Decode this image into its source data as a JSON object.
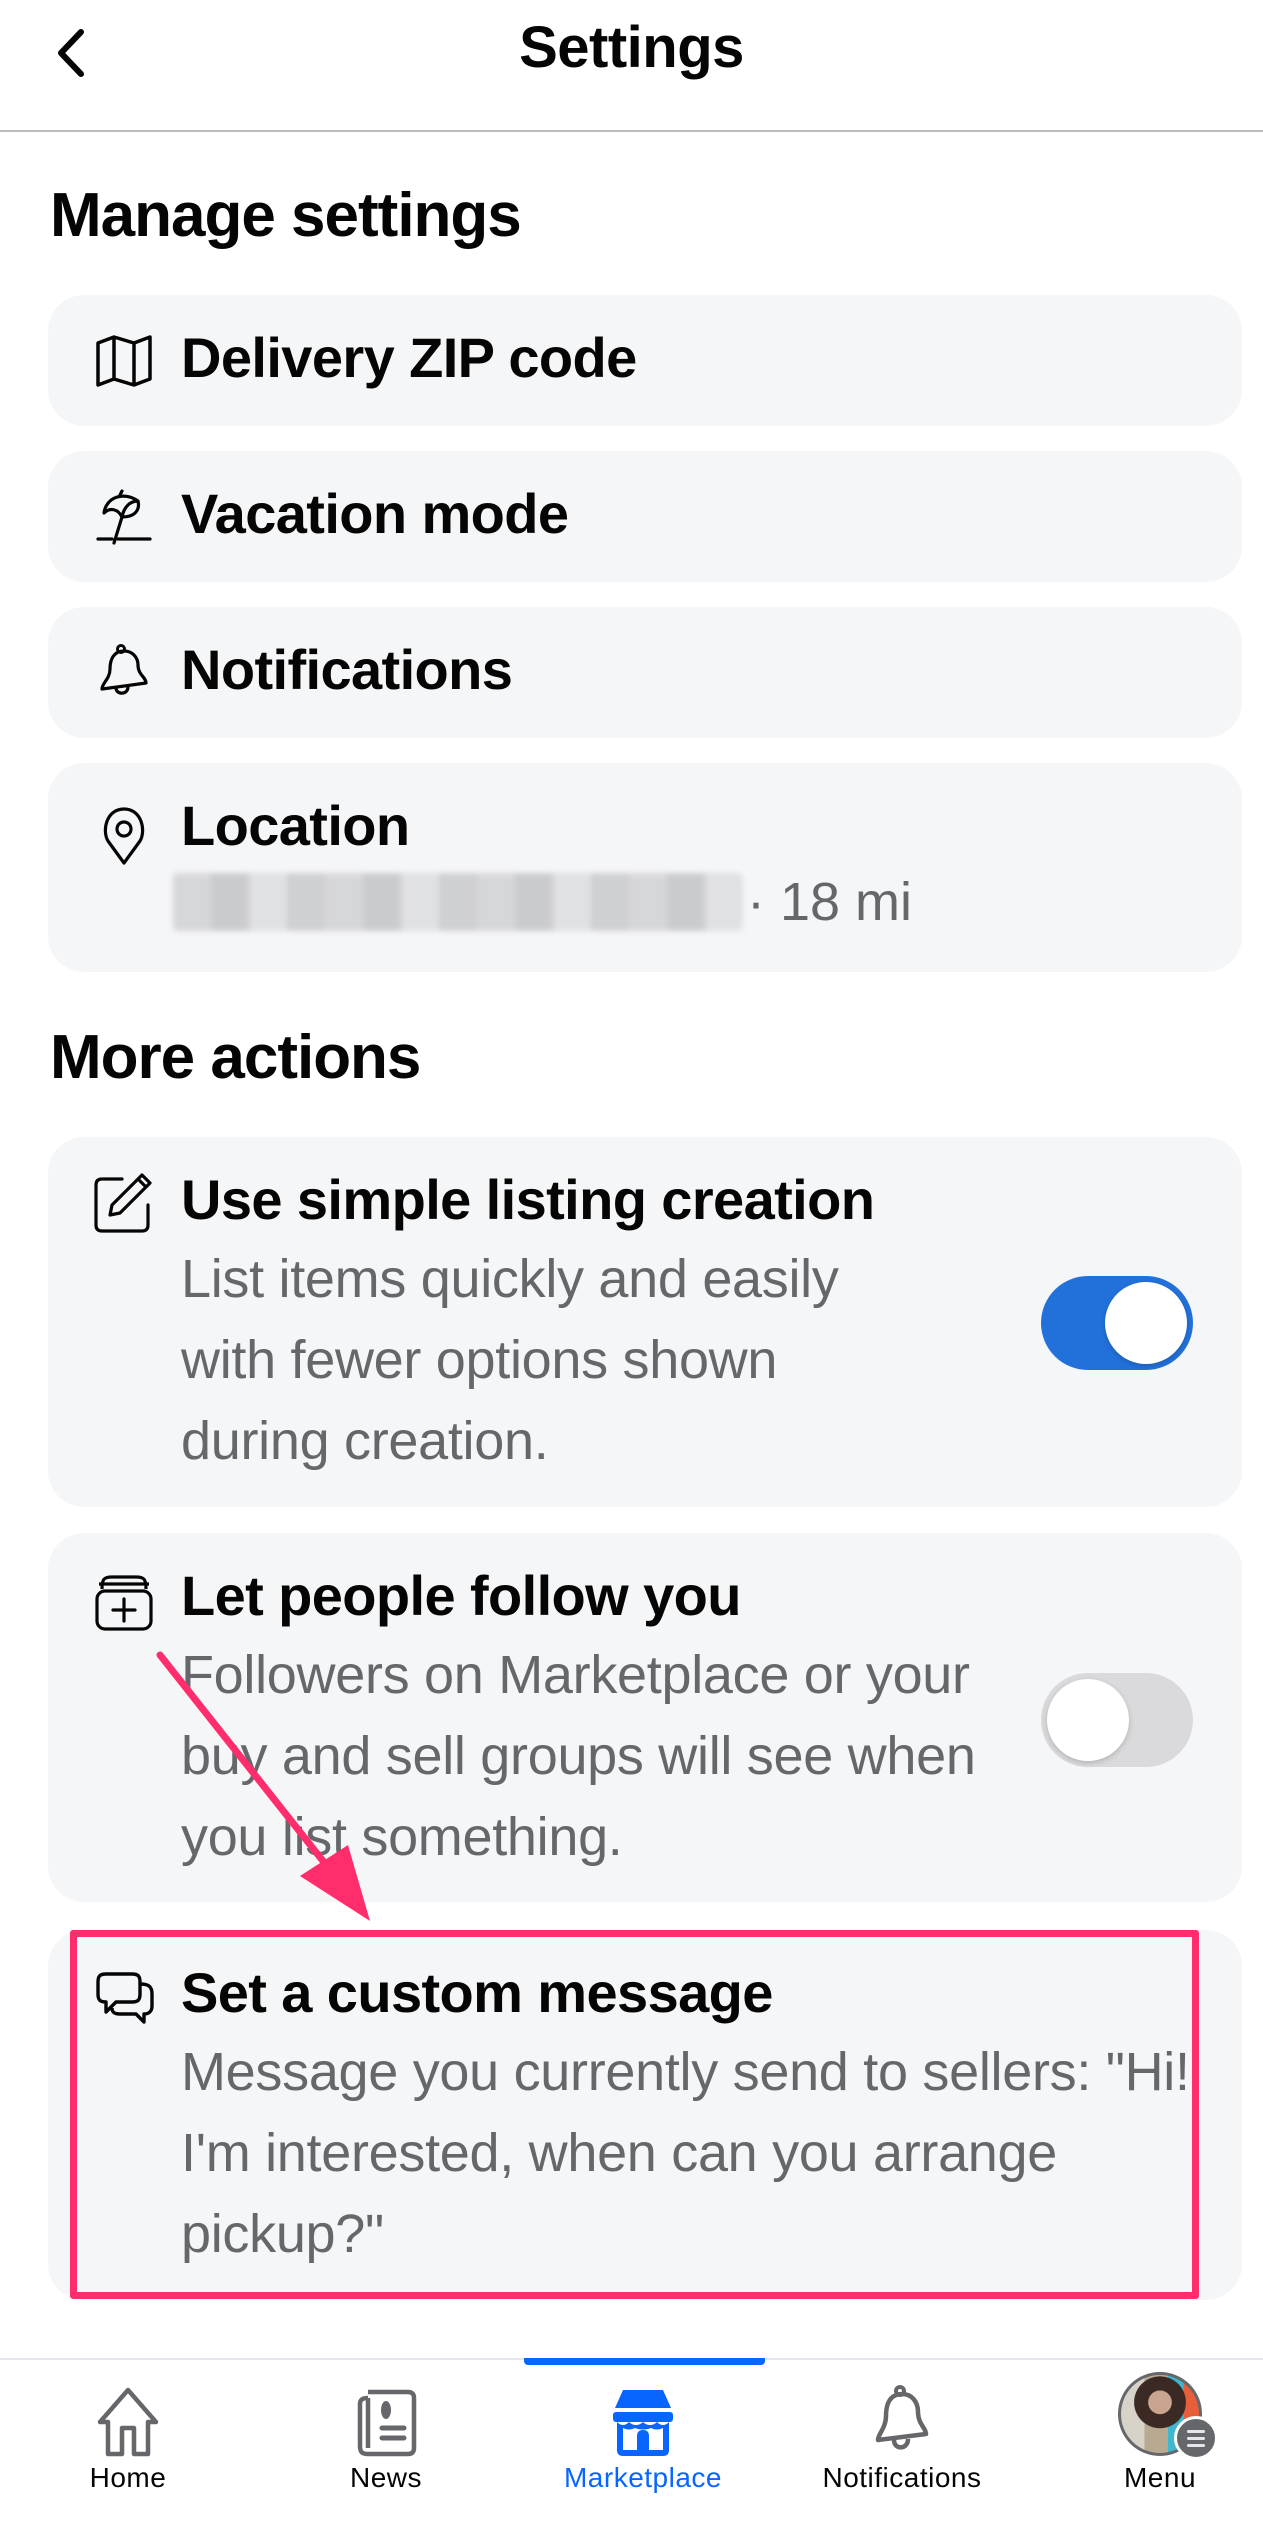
{
  "header": {
    "title": "Settings",
    "back_icon": "chevron-left-icon"
  },
  "manage_settings": {
    "title": "Manage settings",
    "items": [
      {
        "label": "Delivery ZIP code",
        "icon": "map-icon"
      },
      {
        "label": "Vacation mode",
        "icon": "beach-umbrella-icon"
      },
      {
        "label": "Notifications",
        "icon": "bell-icon"
      },
      {
        "label": "Location",
        "icon": "location-pin-icon",
        "value_suffix": "· 18 mi",
        "value_redacted": true
      }
    ]
  },
  "more_actions": {
    "title": "More actions",
    "items": [
      {
        "label": "Use simple listing creation",
        "icon": "edit-icon",
        "description": "List items quickly and easily with fewer options shown during creation.",
        "toggle_on": true
      },
      {
        "label": "Let people follow you",
        "icon": "add-to-stack-icon",
        "description": "Followers on Marketplace or your buy and sell groups will see when you list something.",
        "toggle_on": false
      },
      {
        "label": "Set a custom message",
        "icon": "chat-bubbles-icon",
        "description": "Message you currently send to sellers: \"Hi! I'm interested, when can you arrange pickup?\""
      }
    ]
  },
  "annotation": {
    "highlighted_item": "Set a custom message",
    "color": "#FF2D6B"
  },
  "bottom_nav": {
    "active": "Marketplace",
    "items": [
      {
        "label": "Home",
        "icon": "home-icon"
      },
      {
        "label": "News",
        "icon": "news-feed-icon"
      },
      {
        "label": "Marketplace",
        "icon": "marketplace-shop-icon"
      },
      {
        "label": "Notifications",
        "icon": "bell-icon"
      },
      {
        "label": "Menu",
        "icon": "profile-avatar-menu-icon"
      }
    ]
  },
  "colors": {
    "accent_blue": "#0866FF",
    "toggle_on": "#2271DB",
    "toggle_off": "#DADADC",
    "card_bg": "#F5F6F8",
    "secondary_text": "#65676B"
  }
}
